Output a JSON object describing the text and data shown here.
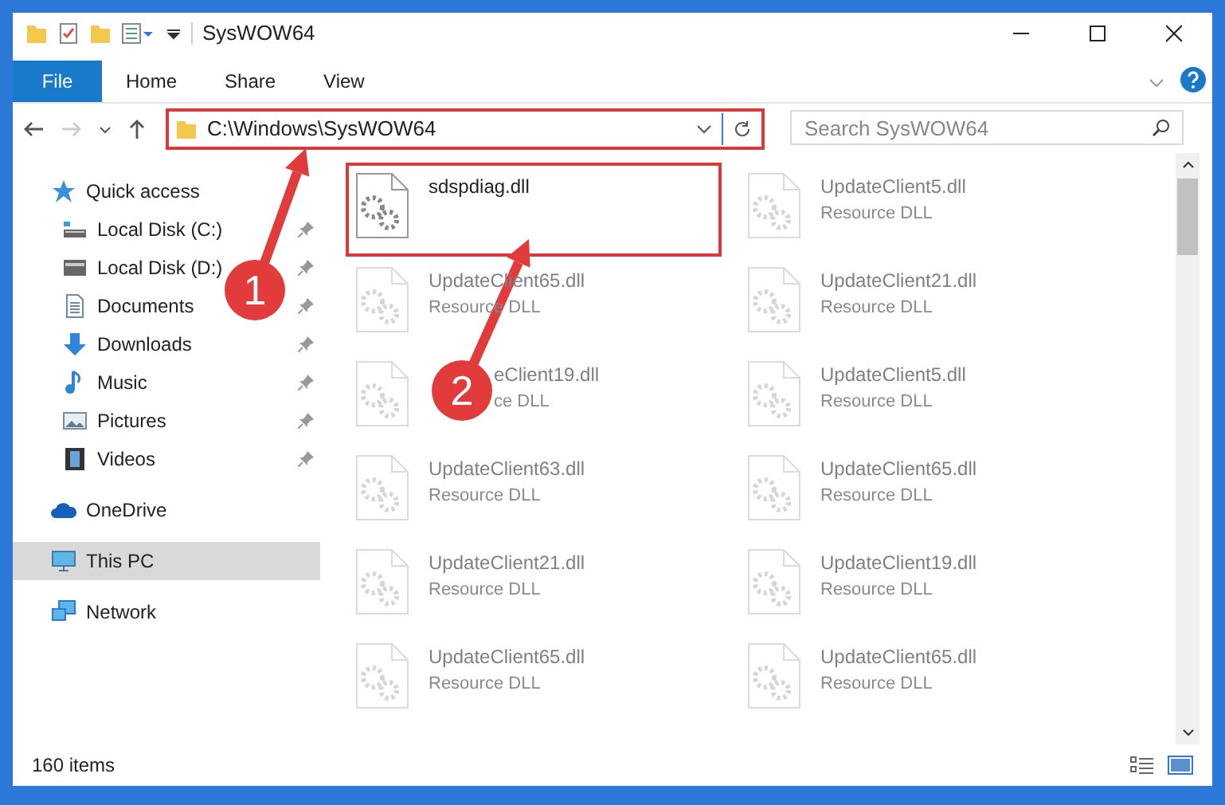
{
  "window": {
    "title": "SysWOW64"
  },
  "ribbon_tabs": [
    {
      "label": "File",
      "selected": true
    },
    {
      "label": "Home",
      "selected": false
    },
    {
      "label": "Share",
      "selected": false
    },
    {
      "label": "View",
      "selected": false
    }
  ],
  "address": {
    "path": "C:\\Windows\\SysWOW64"
  },
  "search": {
    "placeholder": "Search SysWOW64"
  },
  "sidebar": {
    "items": [
      {
        "label": "Quick access",
        "kind": "star",
        "pinned": false,
        "selected": false
      },
      {
        "label": "Local Disk (C:)",
        "kind": "drive-c",
        "pinned": true,
        "selected": false
      },
      {
        "label": "Local Disk (D:)",
        "kind": "drive",
        "pinned": true,
        "selected": false
      },
      {
        "label": "Documents",
        "kind": "documents",
        "pinned": true,
        "selected": false
      },
      {
        "label": "Downloads",
        "kind": "downloads",
        "pinned": true,
        "selected": false
      },
      {
        "label": "Music",
        "kind": "music",
        "pinned": true,
        "selected": false
      },
      {
        "label": "Pictures",
        "kind": "pictures",
        "pinned": true,
        "selected": false
      },
      {
        "label": "Videos",
        "kind": "videos",
        "pinned": true,
        "selected": false
      },
      {
        "label": "OneDrive",
        "kind": "cloud",
        "pinned": false,
        "selected": false
      },
      {
        "label": "This PC",
        "kind": "pc",
        "pinned": false,
        "selected": true
      },
      {
        "label": "Network",
        "kind": "network",
        "pinned": false,
        "selected": false
      }
    ]
  },
  "files": [
    {
      "name": "sdspdiag.dll",
      "dimmed": false,
      "highlighted": true
    },
    {
      "name": "UpdateClient5.dll",
      "type": "Resource DLL",
      "dimmed": true,
      "highlighted": false
    },
    {
      "name": "UpdateClient65.dll",
      "type": "Resource DLL",
      "dimmed": true,
      "highlighted": false
    },
    {
      "name": "UpdateClient21.dll",
      "type": "Resource DLL",
      "dimmed": true,
      "highlighted": false
    },
    {
      "name": "eClient19.dll",
      "type": "ce DLL",
      "dimmed": true,
      "highlighted": false,
      "covered": true
    },
    {
      "name": "UpdateClient5.dll",
      "type": "Resource DLL",
      "dimmed": true,
      "highlighted": false
    },
    {
      "name": "UpdateClient63.dll",
      "type": "Resource DLL",
      "dimmed": true,
      "highlighted": false
    },
    {
      "name": "UpdateClient65.dll",
      "type": "Resource DLL",
      "dimmed": true,
      "highlighted": false
    },
    {
      "name": "UpdateClient21.dll",
      "type": "Resource DLL",
      "dimmed": true,
      "highlighted": false
    },
    {
      "name": "UpdateClient19.dll",
      "type": "Resource DLL",
      "dimmed": true,
      "highlighted": false
    },
    {
      "name": "UpdateClient65.dll",
      "type": "Resource DLL",
      "dimmed": true,
      "highlighted": false
    },
    {
      "name": "UpdateClient65.dll",
      "type": "Resource DLL",
      "dimmed": true,
      "highlighted": false
    }
  ],
  "status_bar": {
    "text": "160 items"
  },
  "annotations": [
    {
      "label": "1"
    },
    {
      "label": "2"
    }
  ]
}
